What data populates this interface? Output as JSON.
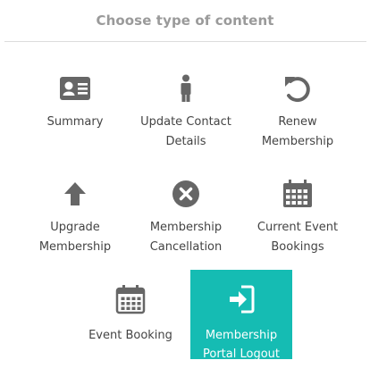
{
  "header": {
    "title": "Choose type of content"
  },
  "items": [
    {
      "label_1": "Summary",
      "label_2": "",
      "icon": "id-card-icon"
    },
    {
      "label_1": "Update Contact",
      "label_2": "Details",
      "icon": "person-icon"
    },
    {
      "label_1": "Renew",
      "label_2": "Membership",
      "icon": "undo-icon"
    },
    {
      "label_1": "Upgrade",
      "label_2": "Membership",
      "icon": "arrow-up-icon"
    },
    {
      "label_1": "Membership",
      "label_2": "Cancellation",
      "icon": "x-circle-icon"
    },
    {
      "label_1": "Current Event",
      "label_2": "Bookings",
      "icon": "calendar-icon"
    },
    {
      "label_1": "Event Booking",
      "label_2": "",
      "icon": "calendar-icon"
    },
    {
      "label_1": "Membership",
      "label_2": "Portal Logout",
      "icon": "sign-in-icon",
      "active": true
    }
  ],
  "colors": {
    "accent": "#15bcb3",
    "icon": "#666666",
    "title": "#9a9a9a",
    "divider": "#dcdcdc"
  }
}
